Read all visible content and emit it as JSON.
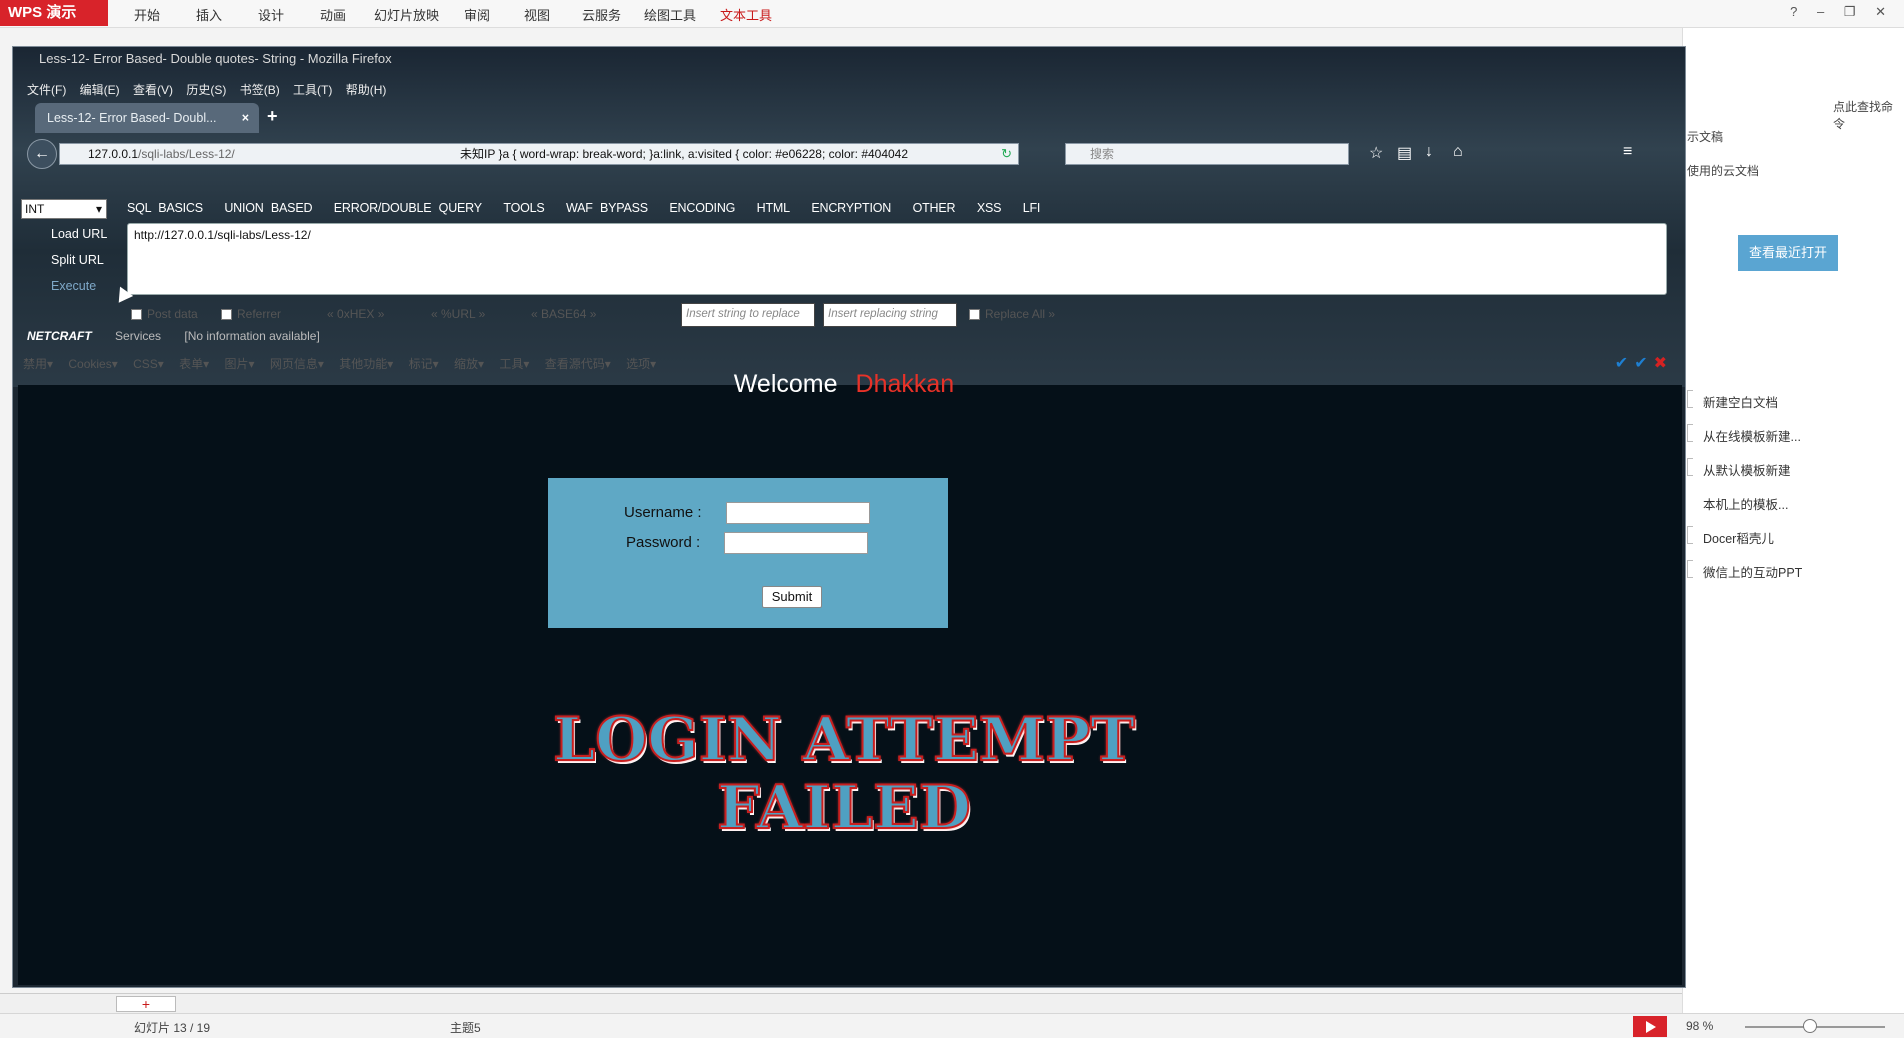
{
  "wps": {
    "logo": "WPS 演示",
    "tabs": [
      "开始",
      "插入",
      "设计",
      "动画",
      "幻灯片放映",
      "审阅",
      "视图",
      "云服务",
      "绘图工具",
      "文本工具"
    ],
    "active_tab": "文本工具",
    "pane": {
      "top_label": "示文稿",
      "cloud_label": "使用的云文档",
      "search_label": "点此查找命令",
      "recent_button": "查看最近打开",
      "items": [
        "新建空白文档",
        "从在线模板新建...",
        "从默认模板新建",
        "本机上的模板...",
        "Docer稻壳儿",
        "微信上的互动PPT"
      ]
    },
    "status": {
      "slide": "幻灯片 13 / 19",
      "theme": "主题5",
      "zoom": "98 %"
    },
    "add_slide": "+"
  },
  "firefox": {
    "title": "Less-12- Error Based- Double quotes- String - Mozilla Firefox",
    "menu": [
      "文件(F)",
      "编辑(E)",
      "查看(V)",
      "历史(S)",
      "书签(B)",
      "工具(T)",
      "帮助(H)"
    ],
    "tab_label": "Less-12- Error Based- Doubl...",
    "tab_close": "×",
    "new_tab": "+",
    "url_host": "127.0.0.1",
    "url_path": "/sqli-labs/Less-12/",
    "url_extra": "未知IP   }a { word-wrap: break-word; }a:link, a:visited { color: #e06228; color: #404042",
    "search_placeholder": "搜索"
  },
  "hackbar": {
    "select_value": "INT",
    "menu": [
      "SQL BASICS",
      "UNION BASED",
      "ERROR/DOUBLE QUERY",
      "TOOLS",
      "WAF BYPASS",
      "ENCODING",
      "HTML",
      "ENCRYPTION",
      "OTHER",
      "XSS",
      "LFI"
    ],
    "load_url": "Load URL",
    "split_url": "Split URL",
    "execute": "Execute",
    "textarea_value": "http://127.0.0.1/sqli-labs/Less-12/",
    "post_data": "Post data",
    "referrer": "Referrer",
    "hex": "0xHEX",
    "url_enc": "%URL",
    "base64": "BASE64",
    "insert_placeholder": "Insert string to replace",
    "replacing_placeholder": "Insert replacing string",
    "replace_all": "Replace All",
    "netcraft": "NETCRAFT",
    "services": "Services",
    "no_info": "[No information available]",
    "toolbar": [
      "禁用▾",
      "Cookies▾",
      "CSS▾",
      "表单▾",
      "图片▾",
      "网页信息▾",
      "其他功能▾",
      "标记▾",
      "缩放▾",
      "工具▾",
      "查看源代码▾",
      "选项▾"
    ]
  },
  "page": {
    "welcome": "Welcome",
    "name": "Dhakkan",
    "username_label": "Username :",
    "password_label": "Password :",
    "submit": "Submit",
    "failed_line1": "LOGIN ATTEMPT",
    "failed_line2": "FAILED"
  },
  "colors": {
    "wps_red": "#d8232a",
    "page_bg": "#051018",
    "login_box": "#5fa8c5",
    "dhakkan": "#e83228",
    "recent_button": "#5aa5d2"
  }
}
